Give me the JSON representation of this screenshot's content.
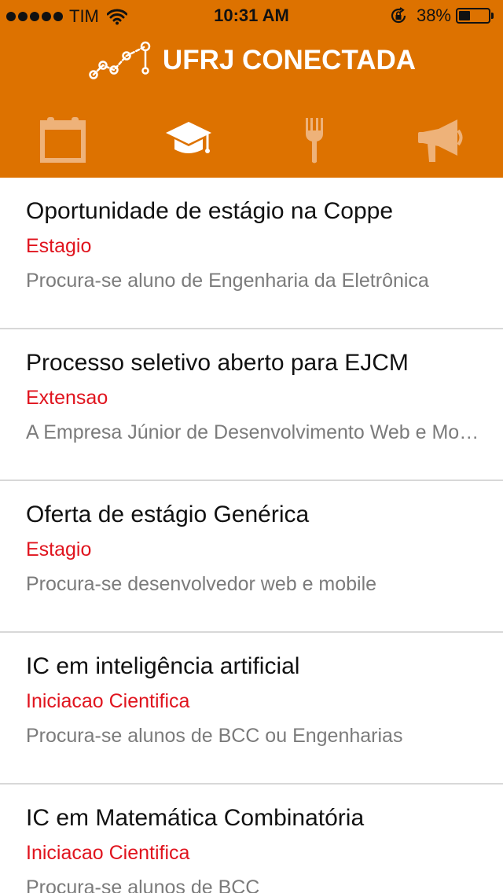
{
  "status_bar": {
    "carrier": "TIM",
    "time": "10:31 AM",
    "battery_percent": "38%",
    "battery_level": 0.38,
    "signal_dots": 5,
    "icons": [
      "signal-dots-icon",
      "wifi-icon",
      "rotation-lock-icon",
      "battery-icon"
    ]
  },
  "header": {
    "title": "UFRJ CONECTADA",
    "logo_icon": "line-graph-logo-icon",
    "background_color": "#dd7200"
  },
  "tabs": [
    {
      "icon": "calendar-icon",
      "selected": false
    },
    {
      "icon": "graduation-cap-icon",
      "selected": true
    },
    {
      "icon": "fork-icon",
      "selected": false
    },
    {
      "icon": "megaphone-icon",
      "selected": false
    }
  ],
  "colors": {
    "accent": "#dd7200",
    "category": "#e0141e",
    "description": "#7b7b7b",
    "tab_inactive": "#eeb279",
    "tab_active": "#ffffff"
  },
  "items": [
    {
      "title": "Oportunidade de estágio na Coppe",
      "category": "Estagio",
      "description": "Procura-se aluno de Engenharia da Eletrônica"
    },
    {
      "title": "Processo seletivo aberto para EJCM",
      "category": "Extensao",
      "description": "A Empresa Júnior de Desenvolvimento Web e Mobile"
    },
    {
      "title": "Oferta de estágio Genérica",
      "category": "Estagio",
      "description": "Procura-se desenvolvedor web e mobile"
    },
    {
      "title": "IC em inteligência artificial",
      "category": "Iniciacao Cientifica",
      "description": "Procura-se alunos de BCC ou Engenharias"
    },
    {
      "title": "IC em Matemática Combinatória",
      "category": "Iniciacao Cientifica",
      "description": "Procura-se alunos de BCC"
    }
  ]
}
